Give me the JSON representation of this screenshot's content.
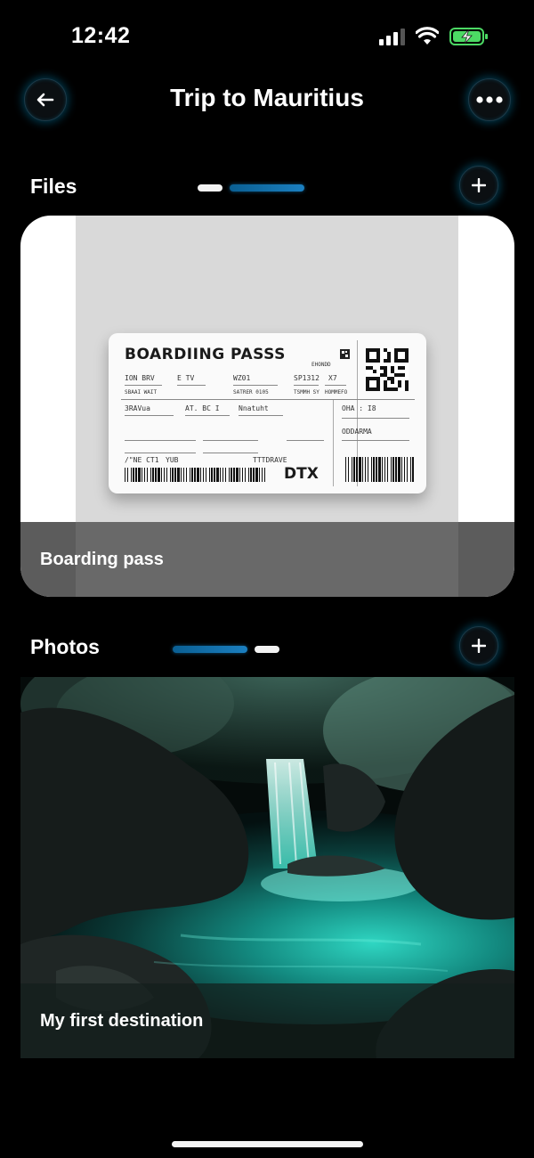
{
  "status_bar": {
    "time": "12:42",
    "icons": [
      "cellular-signal-icon",
      "wifi-icon",
      "battery-charging-icon"
    ],
    "battery_color": "#4cd964"
  },
  "header": {
    "title": "Trip to Mauritius",
    "back_icon": "arrow-left-icon",
    "more_icon": "ellipsis-icon"
  },
  "files": {
    "title": "Files",
    "add_icon": "plus-icon",
    "pager": {
      "count": 2,
      "active": 1
    },
    "items": [
      {
        "caption": "Boarding pass",
        "ticket": {
          "heading": "BOARDIING PASSS",
          "brand": "DTX",
          "row1": [
            "ION BRV",
            "E TV",
            "WZ01",
            "SP1312",
            "X7"
          ],
          "row2": [
            "SBAAI WAIT",
            "SATRER 0105",
            "TSMMH SY",
            "HOMMEFO"
          ],
          "row3": [
            "3RAVua",
            "AT. BC I",
            "Nnatuht",
            "OHA : I8"
          ],
          "row4": [
            "ODDARMA"
          ],
          "row5": [
            "/\"NE CT1",
            "YUB",
            "TTTDRAVE"
          ],
          "small_mark": "EHONDD"
        }
      }
    ]
  },
  "photos": {
    "title": "Photos",
    "add_icon": "plus-icon",
    "pager": {
      "count": 2,
      "active": 0
    },
    "items": [
      {
        "caption": "My first destination"
      }
    ]
  },
  "colors": {
    "accent": "#1b7fc0",
    "button_glow": "#00aae6",
    "background": "#000000"
  }
}
